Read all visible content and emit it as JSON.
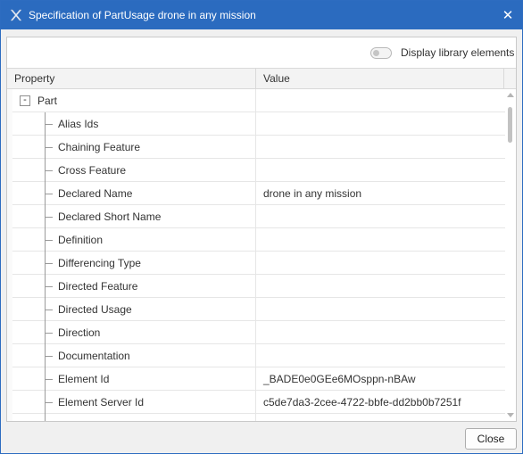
{
  "window": {
    "title": "Specification of PartUsage drone in any mission",
    "app_icon": "x-app-icon",
    "close_icon": "close-icon"
  },
  "toolbar": {
    "toggle_label": "Display library elements",
    "toggle_on": false
  },
  "grid": {
    "columns": {
      "property": "Property",
      "value": "Value"
    },
    "group": {
      "label": "Part",
      "expander": "-"
    },
    "rows": [
      {
        "property": "Alias Ids",
        "value": ""
      },
      {
        "property": "Chaining Feature",
        "value": ""
      },
      {
        "property": "Cross Feature",
        "value": ""
      },
      {
        "property": "Declared Name",
        "value": "drone in any mission"
      },
      {
        "property": "Declared Short Name",
        "value": ""
      },
      {
        "property": "Definition",
        "value": ""
      },
      {
        "property": "Differencing Type",
        "value": ""
      },
      {
        "property": "Directed Feature",
        "value": ""
      },
      {
        "property": "Directed Usage",
        "value": ""
      },
      {
        "property": "Direction",
        "value": ""
      },
      {
        "property": "Documentation",
        "value": ""
      },
      {
        "property": "Element Id",
        "value": "_BADE0e0GEe6MOsppn-nBAw"
      },
      {
        "property": "Element Server Id",
        "value": "c5de7da3-2cee-4722-bbfe-dd2bb0b7251f"
      }
    ]
  },
  "footer": {
    "close_label": "Close"
  },
  "colors": {
    "titlebar": "#2b6bbf",
    "accent_border": "#2d6cc0"
  }
}
